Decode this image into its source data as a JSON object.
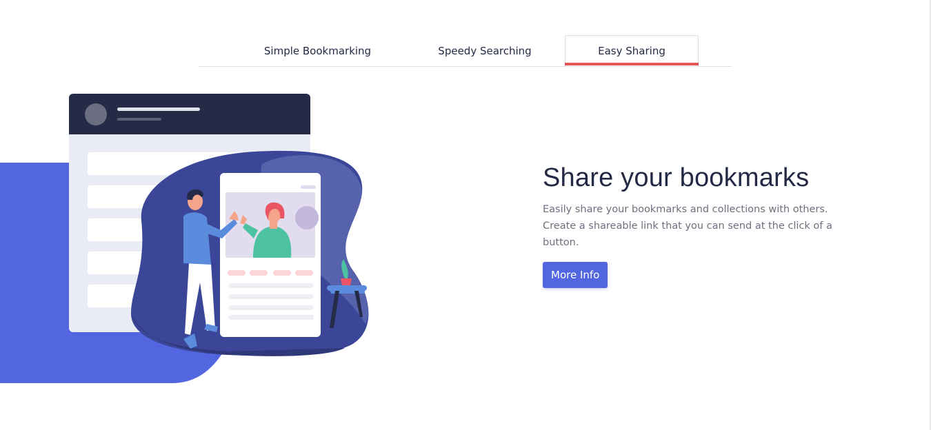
{
  "tabs": [
    {
      "label": "Simple Bookmarking",
      "active": false
    },
    {
      "label": "Speedy Searching",
      "active": false
    },
    {
      "label": "Easy Sharing",
      "active": true
    }
  ],
  "feature": {
    "heading": "Share your bookmarks",
    "description": "Easily share your bookmarks and collections with others. Create a shareable link that you can send at the click of a button.",
    "button_label": "More Info"
  },
  "colors": {
    "primary_blue": "#5267df",
    "soft_red": "#e95556",
    "navy": "#242a45",
    "grey_text": "#6d6f7e"
  },
  "illustration": {
    "name": "sharing-illustration"
  }
}
